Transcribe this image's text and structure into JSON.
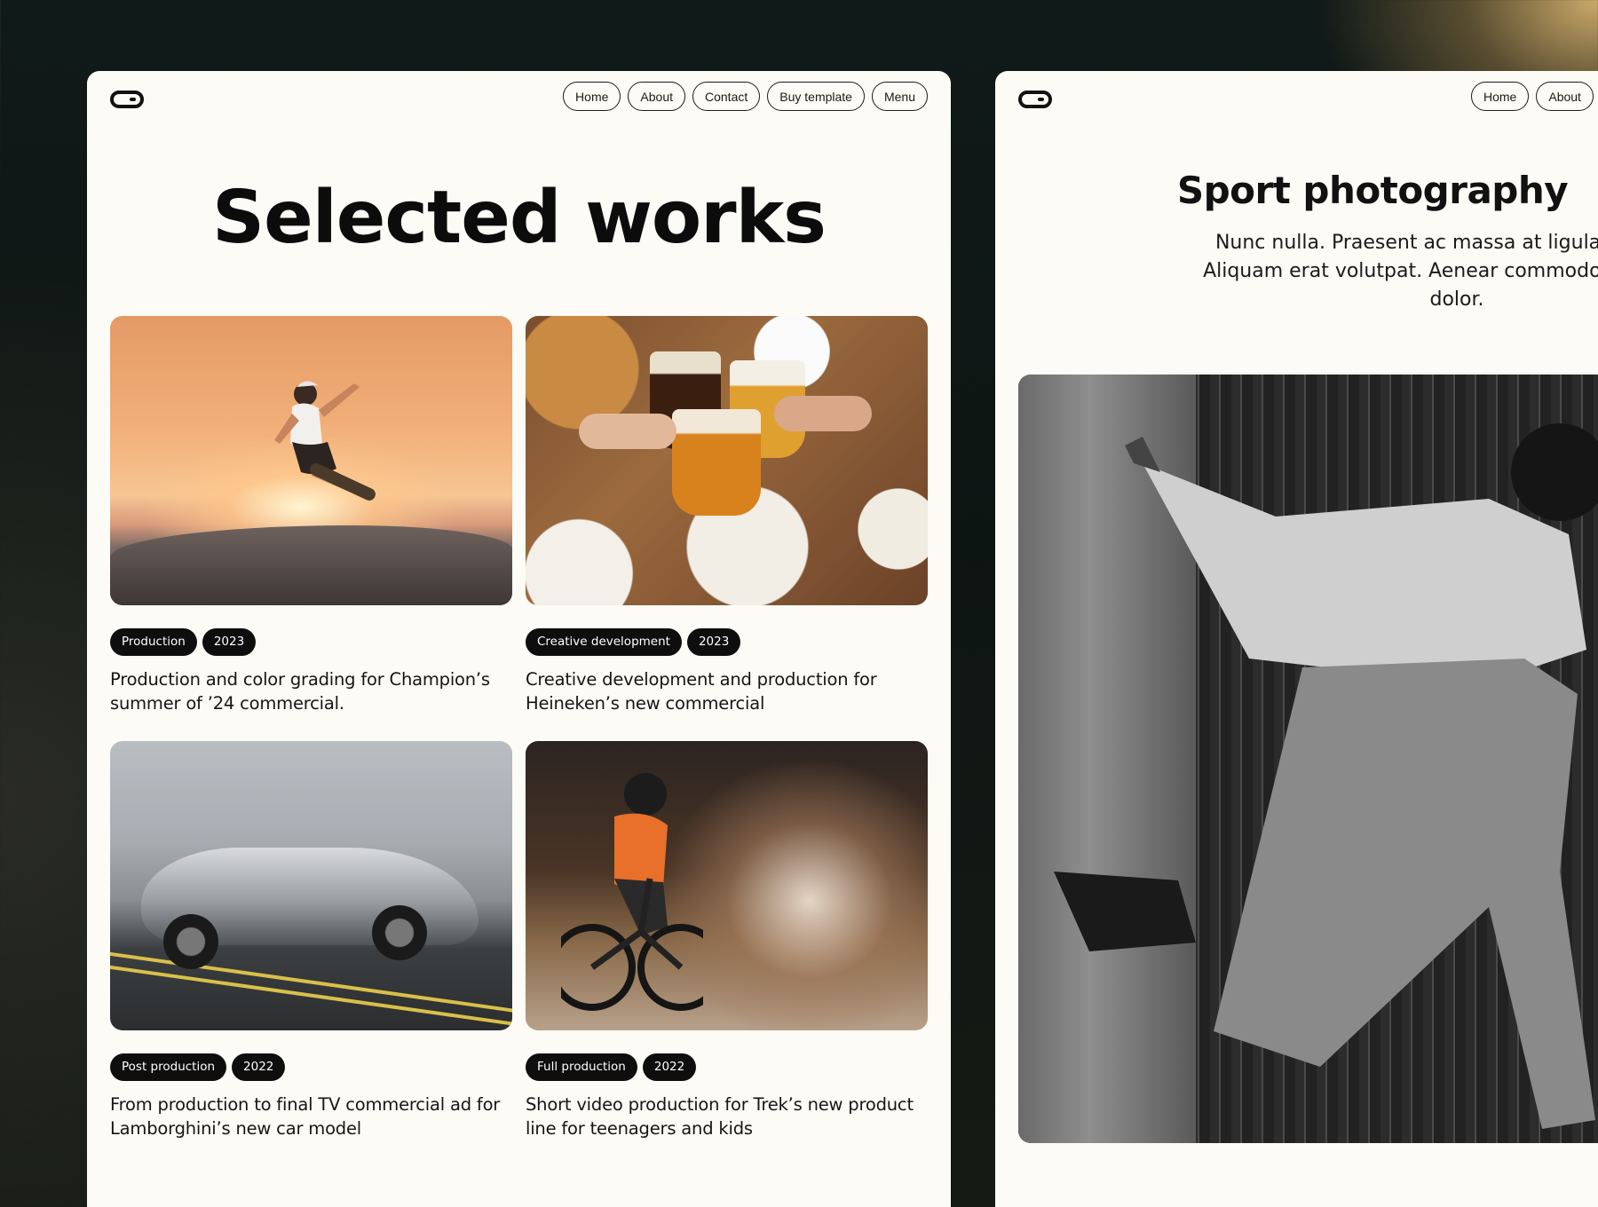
{
  "nav_left": [
    "Home",
    "About",
    "Contact",
    "Buy template",
    "Menu"
  ],
  "nav_right": [
    "Home",
    "About"
  ],
  "page_title": "Selected works",
  "works": [
    {
      "tags": [
        "Production",
        "2023"
      ],
      "description": "Production and color grading for Champion’s summer of ’24 commercial."
    },
    {
      "tags": [
        "Creative development",
        "2023"
      ],
      "description": "Creative development and production for Heineken’s new commercial"
    },
    {
      "tags": [
        "Post production",
        "2022"
      ],
      "description": "From production to final TV commercial ad for Lamborghini’s new car model"
    },
    {
      "tags": [
        "Full production",
        "2022"
      ],
      "description": "Short video production for Trek’s new product line for teenagers and kids"
    }
  ],
  "right_title": "Sport photography",
  "right_text": "Nunc nulla. Praesent ac massa at ligula la iaculis. Aliquam erat volutpat. Aenear commodo ligula eget dolor.",
  "icons": {
    "logo": "pill-logo-icon"
  }
}
